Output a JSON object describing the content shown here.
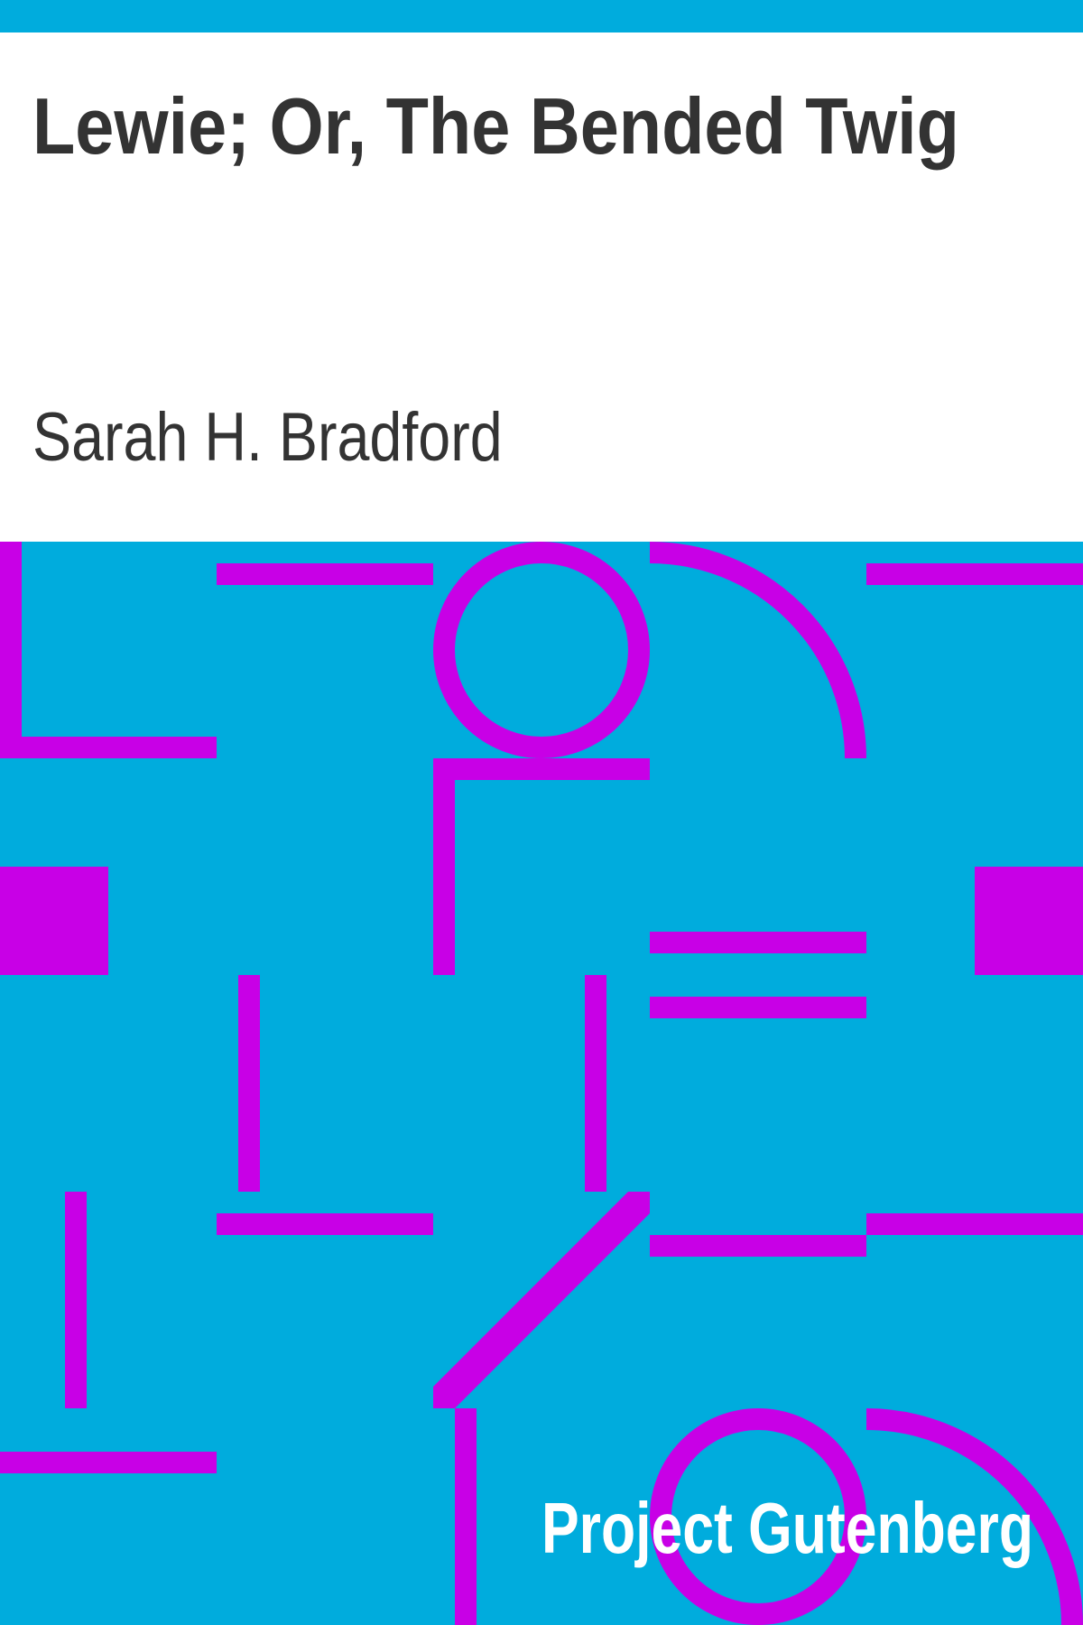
{
  "book": {
    "title": "Lewie; Or, The Bended Twig",
    "author": "Sarah H. Bradford"
  },
  "publisher": {
    "name": "Project Gutenberg"
  },
  "colors": {
    "accent": "#00acdd",
    "pattern": "#c800e6",
    "title_text": "#333333",
    "brand_text": "#ffffff"
  }
}
